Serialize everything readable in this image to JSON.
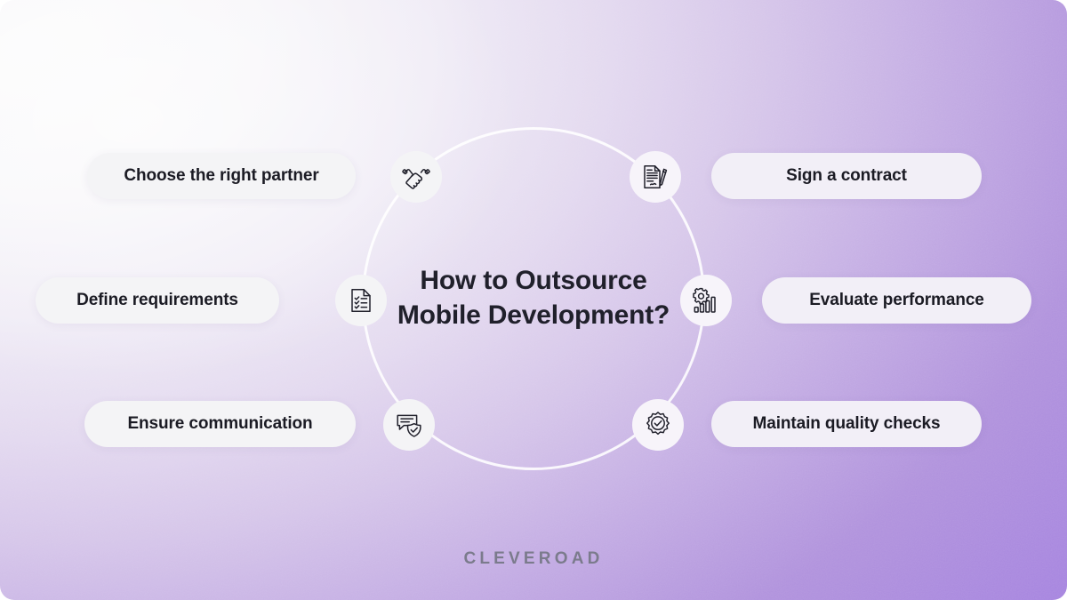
{
  "brand": {
    "name": "CLEVEROAD"
  },
  "title": {
    "line1": "How to Outsource",
    "line2": "Mobile Development?"
  },
  "colors": {
    "gradient_start": "#fbfbfc",
    "gradient_end": "#a684e0",
    "pill_left_bg": "#f4f4f6",
    "pill_right_bg": "#f2eff7",
    "text": "#20202b",
    "brand_text": "#7b7b8c",
    "ring": "#ffffff"
  },
  "steps": [
    {
      "label": "Choose the right partner",
      "icon": "handshake-icon",
      "side": "left"
    },
    {
      "label": "Sign a contract",
      "icon": "contract-document-pen-icon",
      "side": "right"
    },
    {
      "label": "Define requirements",
      "icon": "checklist-document-icon",
      "side": "left"
    },
    {
      "label": "Evaluate performance",
      "icon": "gear-bar-chart-icon",
      "side": "right"
    },
    {
      "label": "Ensure communication",
      "icon": "chat-shield-check-icon",
      "side": "left"
    },
    {
      "label": "Maintain quality checks",
      "icon": "quality-badge-check-icon",
      "side": "right"
    }
  ]
}
